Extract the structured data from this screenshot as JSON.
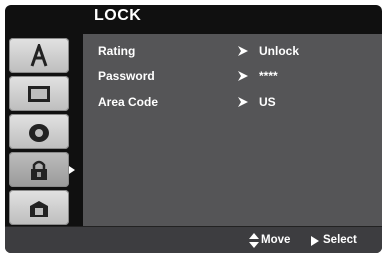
{
  "title": "LOCK",
  "rows": [
    {
      "label": "Rating",
      "value": "Unlock"
    },
    {
      "label": "Password",
      "value": "****"
    },
    {
      "label": "Area Code",
      "value": "US"
    }
  ],
  "footer": {
    "move_label": "Move",
    "select_label": "Select"
  },
  "sidebar": {
    "icons": [
      "language-icon",
      "display-icon",
      "audio-icon",
      "lock-icon",
      "others-icon"
    ],
    "active_icon": "lock-icon"
  },
  "colors": {
    "panel": "#555557",
    "screen": "#101010",
    "footer": "#3d3d40"
  }
}
